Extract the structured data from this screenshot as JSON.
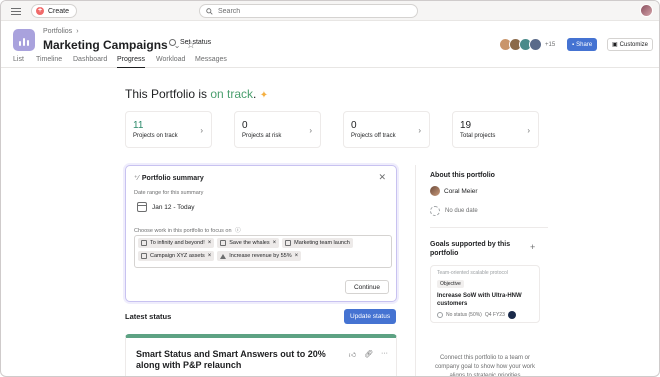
{
  "topbar": {
    "create_label": "Create",
    "search_placeholder": "Search"
  },
  "header": {
    "breadcrumb": "Portfolios",
    "title": "Marketing Campaigns",
    "set_status_label": "Set status",
    "members_more": "+15",
    "share_label": "Share",
    "customize_label": "Customize"
  },
  "tabs": [
    "List",
    "Timeline",
    "Dashboard",
    "Progress",
    "Workload",
    "Messages"
  ],
  "active_tab": "Progress",
  "main": {
    "headline_prefix": "This Portfolio is ",
    "headline_status": "on track",
    "headline_suffix": "."
  },
  "stats": [
    {
      "value": "11",
      "label": "Projects on track"
    },
    {
      "value": "0",
      "label": "Projects at risk"
    },
    {
      "value": "0",
      "label": "Projects off track"
    },
    {
      "value": "19",
      "label": "Total projects"
    }
  ],
  "summary": {
    "title": "Portfolio summary",
    "date_range_label": "Date range for this summary",
    "date_range_value": "Jan 12 - Today",
    "work_label": "Choose work in this portfolio to focus on",
    "chips_row1": [
      "To infinity and beyond!",
      "Save the whales",
      "Marketing team launch"
    ],
    "chips_row2": [
      "Campaign XYZ assets",
      "Increase revenue by 55%"
    ],
    "continue_label": "Continue"
  },
  "latest_status": {
    "label": "Latest status",
    "update_label": "Update status",
    "card_title": "Smart Status and Smart Answers out to 20% along with P&P relaunch"
  },
  "about": {
    "label": "About this portfolio",
    "owner": "Coral Meier",
    "due": "No due date",
    "goals_label": "Goals supported by this portfolio",
    "goal_team": "Team-oriented scalable protocol",
    "goal_tag": "Objective",
    "goal_name": "Increase SoW with Ultra-HNW customers",
    "goal_meta_status": "No status (50%)",
    "goal_meta_period": "Q4 FY23",
    "connect_text": "Connect this portfolio to a team or company goal to show how your work aligns to strategic priorities"
  },
  "colors": {
    "accent_blue": "#4573d2",
    "on_track_green": "#4a9f6e",
    "create_red": "#f06a6a",
    "status_bar_green": "#5da283",
    "portfolio_icon": "#a9a2dd"
  }
}
